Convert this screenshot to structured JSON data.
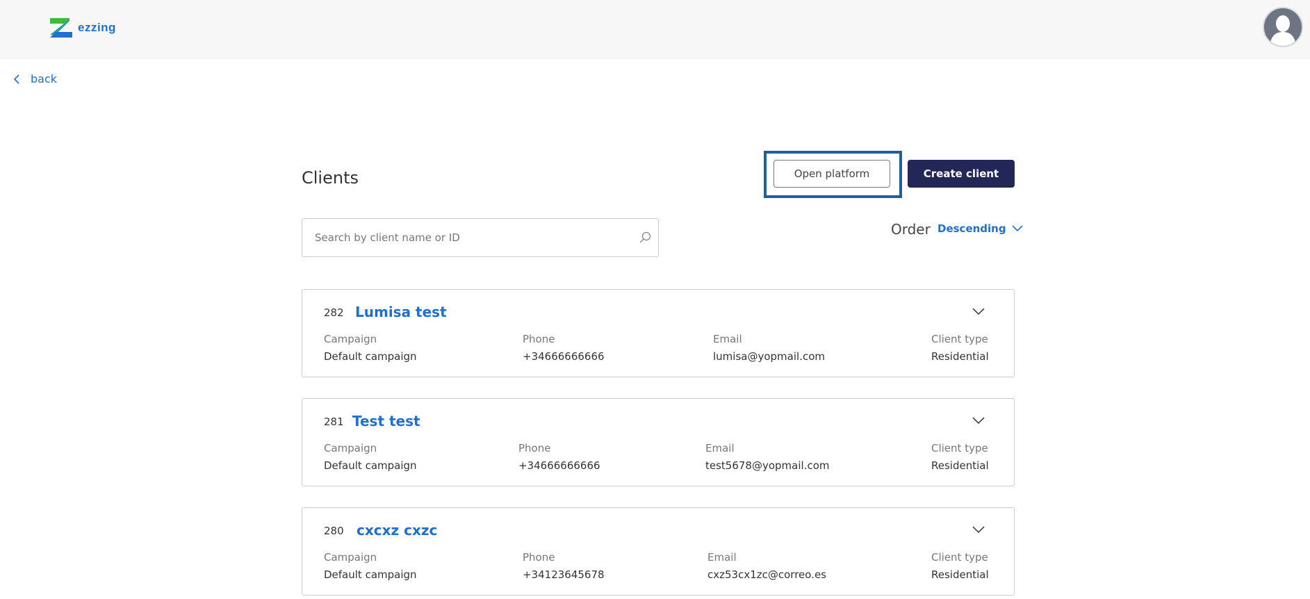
{
  "header": {
    "logo_text": "ezzing",
    "avatar_label": "user-avatar"
  },
  "nav": {
    "back_label": "back"
  },
  "page": {
    "title": "Clients"
  },
  "toolbar": {
    "open_platform_label": "Open platform",
    "create_client_label": "Create client"
  },
  "search": {
    "placeholder": "Search by client name or ID"
  },
  "order": {
    "label": "Order",
    "selected": "Descending"
  },
  "field_labels": {
    "campaign": "Campaign",
    "phone": "Phone",
    "email": "Email",
    "client_type": "Client type"
  },
  "clients": [
    {
      "id": "282",
      "name": "Lumisa test",
      "campaign": "Default campaign",
      "phone": "+34666666666",
      "email": "lumisa@yopmail.com",
      "client_type": "Residential"
    },
    {
      "id": "281",
      "name": "Test test",
      "campaign": "Default campaign",
      "phone": "+34666666666",
      "email": "test5678@yopmail.com",
      "client_type": "Residential"
    },
    {
      "id": "280",
      "name": "cxcxz cxzc",
      "campaign": "Default campaign",
      "phone": "+34123645678",
      "email": "cxz53cx1zc@correo.es",
      "client_type": "Residential"
    }
  ],
  "colors": {
    "accent": "#1f6fd1",
    "primary_button": "#232757",
    "highlight": "#1f5f9e"
  }
}
